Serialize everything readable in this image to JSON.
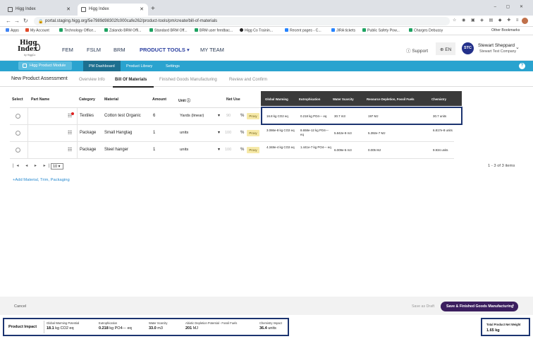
{
  "browser": {
    "tabs": [
      {
        "title": "Higg Index",
        "active": false
      },
      {
        "title": "Higg Index",
        "active": true
      }
    ],
    "url": "portal.staging.higg.org/5e7989d98302fc000cafe262/product-tools/pm/create/bill-of-materials",
    "bookmarks": [
      {
        "label": "Apps",
        "icon": "apps-grid-icon"
      },
      {
        "label": "My Account",
        "icon": "account-icon"
      },
      {
        "label": "Technology Office...",
        "icon": "doc-icon"
      },
      {
        "label": "Zalando BRM Offi...",
        "icon": "doc-icon"
      },
      {
        "label": "Standard BRM Off...",
        "icon": "doc-icon"
      },
      {
        "label": "BRM user feedbac...",
        "icon": "doc-icon"
      },
      {
        "label": "Higg Co Trainin...",
        "icon": "higg-icon"
      },
      {
        "label": "Recent pages - C...",
        "icon": "confluence-icon"
      },
      {
        "label": "JIRA tickets",
        "icon": "jira-icon"
      },
      {
        "label": "Public Safety Pow...",
        "icon": "doc-icon"
      },
      {
        "label": "Charges Debussy",
        "icon": "doc-icon"
      }
    ],
    "other_bookmarks": "Other Bookmarks"
  },
  "header": {
    "logo_line1": "Higg",
    "logo_line2": "Index",
    "logo_sub": "by HiggCo",
    "nav": [
      "FEM",
      "FSLM",
      "BRM",
      "PRODUCT TOOLS ▾",
      "MY TEAM"
    ],
    "support": "Support",
    "lang": "EN",
    "user_initials": "STC",
    "user_name": "Stewart Sheppard",
    "user_company": "Stewart Test Company"
  },
  "subnav": {
    "module": "Higg Product Module",
    "items": [
      "PM Dashboard",
      "Product Library",
      "Settings"
    ],
    "help": "?"
  },
  "steps": {
    "title": "New Product Assessment",
    "items": [
      "Overview Info",
      "Bill Of Materials",
      "Finished Goods Manufacturing",
      "Review and Confirm"
    ]
  },
  "table": {
    "columns": [
      "Select",
      "Part Name",
      "Category",
      "Material",
      "Amount",
      "Unit ⓘ",
      "Net Use"
    ],
    "impact_columns": [
      "Global Warming",
      "Eutrophication",
      "Water Scarcity",
      "Resource Depletion, Fossil Fuels",
      "Chemistry"
    ],
    "rows": [
      {
        "category": "Textiles",
        "material": "Cotton test Organic",
        "amount": "6",
        "unit": "Yards (linear)",
        "net_use": "90",
        "pct": "%",
        "proxy": "Proxy",
        "gw": "16.8 kg CO2 eq",
        "eu": "0.218 kg PO4--- eq",
        "ws": "30.7 m3",
        "rd": "197 MJ",
        "ch": "30.7 units"
      },
      {
        "category": "Package",
        "material": "Small Hangtag",
        "amount": "1",
        "unit": "units",
        "net_use": "100",
        "pct": "%",
        "proxy": "Proxy",
        "gw": "3.086e-8 kg CO2 eq",
        "eu": "8.658e-12 kg PO4--- eq",
        "ws": "5.842e-9 m3",
        "rd": "5.392e-7 MJ",
        "ch": "6.817e-8 units"
      },
      {
        "category": "Package",
        "material": "Steel hanger",
        "amount": "1",
        "unit": "units",
        "net_use": "100",
        "pct": "%",
        "proxy": "Proxy",
        "gw": "4.348e-4 kg CO2 eq",
        "eu": "1.441e-7 kg PO4--- eq",
        "ws": "6.009e-5 m3",
        "rd": "0.005 MJ",
        "ch": "9.934 units"
      }
    ],
    "page_size": "10",
    "page_count": "1 - 3 of 3 items",
    "add_link": "+Add Material, Trim, Packaging"
  },
  "footer": {
    "cancel": "Cancel",
    "save_draft": "Save as Draft",
    "save_next": "Save & Finished Goods Manufacturing"
  },
  "product_impact": {
    "label": "Product Impact",
    "metrics": [
      {
        "title": "Global Warming Potential",
        "value": "18.1",
        "unit": "kg CO2 eq"
      },
      {
        "title": "Eutrophication",
        "value": "0.218",
        "unit": "kg PO4--- eq"
      },
      {
        "title": "Water Scarcity",
        "value": "33.0",
        "unit": "m3"
      },
      {
        "title": "Abiotic Depletion Potential - Fossil Fuels",
        "value": "201",
        "unit": "MJ"
      },
      {
        "title": "Chemistry Impact",
        "value": "36.4",
        "unit": "units"
      }
    ],
    "net_weight_title": "Total Product Net Weight",
    "net_weight_value": "1.65 kg"
  },
  "colors": {
    "accent_blue": "#2aa3cf",
    "nav_active": "#2b3fa0",
    "save_button": "#3b1e5e",
    "highlight_box": "#1c3470",
    "proxy_badge": "#f6e9a8"
  }
}
